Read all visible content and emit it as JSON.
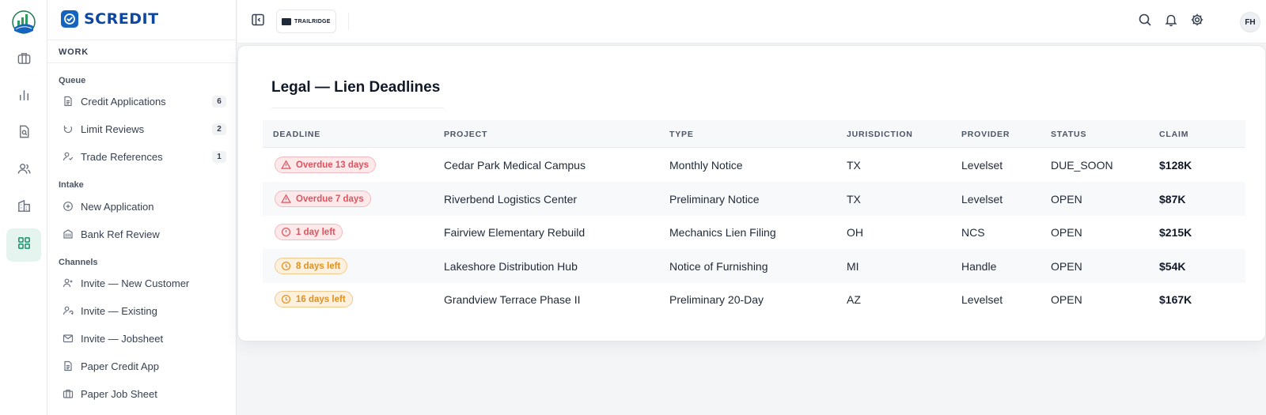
{
  "rail": {
    "items": [
      "briefcase-icon",
      "bar-chart-icon",
      "document-search-icon",
      "users-icon",
      "building-icon",
      "grid-icon"
    ],
    "active": "grid-icon"
  },
  "brand": {
    "name": "SCREDIT",
    "color": "#1565c0"
  },
  "sidebar": {
    "section_title": "WORK",
    "groups": [
      {
        "label": "Queue",
        "items": [
          {
            "label": "Credit Applications",
            "count": "6",
            "icon": "document-icon"
          },
          {
            "label": "Limit Reviews",
            "count": "2",
            "icon": "refresh-icon"
          },
          {
            "label": "Trade References",
            "count": "1",
            "icon": "user-check-icon"
          }
        ]
      },
      {
        "label": "Intake",
        "items": [
          {
            "label": "New Application",
            "icon": "plus-circle-icon"
          },
          {
            "label": "Bank Ref Review",
            "icon": "bank-icon"
          }
        ]
      },
      {
        "label": "Channels",
        "items": [
          {
            "label": "Invite — New Customer",
            "icon": "user-plus-icon"
          },
          {
            "label": "Invite — Existing",
            "icon": "user-refresh-icon"
          },
          {
            "label": "Invite — Jobsheet",
            "icon": "mail-icon"
          },
          {
            "label": "Paper Credit App",
            "icon": "document-icon"
          },
          {
            "label": "Paper Job Sheet",
            "icon": "briefcase-icon"
          }
        ]
      }
    ]
  },
  "topbar": {
    "org_name": "TRAILRIDGE",
    "avatar_initials": "FH",
    "icons": [
      "search-icon",
      "bell-icon",
      "gear-icon"
    ]
  },
  "page": {
    "title": "Legal — Lien Deadlines",
    "columns": [
      "DEADLINE",
      "PROJECT",
      "TYPE",
      "JURISDICTION",
      "PROVIDER",
      "STATUS",
      "CLAIM"
    ],
    "rows": [
      {
        "deadline": "Overdue 13 days",
        "severity": "overdue",
        "project": "Cedar Park Medical Campus",
        "type": "Monthly Notice",
        "jurisdiction": "TX",
        "provider": "Levelset",
        "status": "DUE_SOON",
        "claim": "$128K"
      },
      {
        "deadline": "Overdue 7 days",
        "severity": "overdue",
        "project": "Riverbend Logistics Center",
        "type": "Preliminary Notice",
        "jurisdiction": "TX",
        "provider": "Levelset",
        "status": "OPEN",
        "claim": "$87K"
      },
      {
        "deadline": "1 day left",
        "severity": "urgent",
        "project": "Fairview Elementary Rebuild",
        "type": "Mechanics Lien Filing",
        "jurisdiction": "OH",
        "provider": "NCS",
        "status": "OPEN",
        "claim": "$215K"
      },
      {
        "deadline": "8 days left",
        "severity": "soon",
        "project": "Lakeshore Distribution Hub",
        "type": "Notice of Furnishing",
        "jurisdiction": "MI",
        "provider": "Handle",
        "status": "OPEN",
        "claim": "$54K"
      },
      {
        "deadline": "16 days left",
        "severity": "soon",
        "project": "Grandview Terrace Phase II",
        "type": "Preliminary 20-Day",
        "jurisdiction": "AZ",
        "provider": "Levelset",
        "status": "OPEN",
        "claim": "$167K"
      }
    ]
  },
  "colors": {
    "accent": "#1565c0",
    "active_rail": "#1a8f6a",
    "overdue": "#e0525e",
    "soon": "#e0901e"
  }
}
